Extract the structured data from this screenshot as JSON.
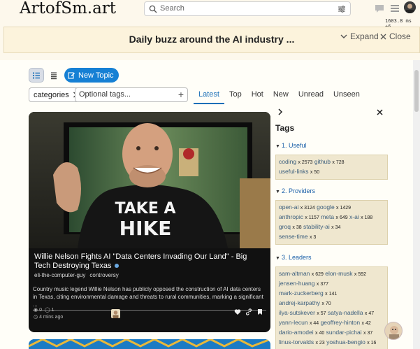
{
  "header": {
    "logo": "ArtofSm.art",
    "search_placeholder": "Search",
    "perf_readout": "1603.8 ms +6"
  },
  "banner": {
    "title": "Daily buzz around the AI industry ...",
    "expand_label": "Expand",
    "close_label": "Close"
  },
  "toolbar": {
    "new_topic_label": "New Topic",
    "categories_label": "categories",
    "tags_placeholder": "Optional tags...",
    "tabs": [
      {
        "label": "Latest",
        "active": true
      },
      {
        "label": "Top",
        "active": false
      },
      {
        "label": "Hot",
        "active": false
      },
      {
        "label": "New",
        "active": false
      },
      {
        "label": "Unread",
        "active": false
      },
      {
        "label": "Unseen",
        "active": false
      }
    ]
  },
  "card": {
    "title": "Willie Nelson Fights AI \"Data Centers Invading Our Land\" - Big Tech Destroying Texas",
    "tags": [
      "eli-the-computer-guy",
      "controversy"
    ],
    "excerpt": "Country music legend Willie Nelson has publicly opposed the construction of AI data centers in Texas, citing environmental damage and threats to rural communities, marking a significant ...",
    "views": "0",
    "replies": "1",
    "time": "4 mins ago",
    "shirt_text_1": "TAKE A",
    "shirt_text_2": "HIKE"
  },
  "tags_panel": {
    "title": "Tags",
    "sections": [
      {
        "label": "1. Useful",
        "lines": [
          [
            {
              "tag": "coding",
              "count": "x 2573"
            },
            {
              "tag": "github",
              "count": "x 728"
            }
          ],
          [
            {
              "tag": "useful-links",
              "count": "x 50"
            }
          ]
        ]
      },
      {
        "label": "2. Providers",
        "lines": [
          [
            {
              "tag": "open-ai",
              "count": "x 3124"
            },
            {
              "tag": "google",
              "count": "x 1429"
            }
          ],
          [
            {
              "tag": "anthropic",
              "count": "x 1157"
            },
            {
              "tag": "meta",
              "count": "x 649"
            },
            {
              "tag": "x-ai",
              "count": "x 188"
            }
          ],
          [
            {
              "tag": "groq",
              "count": "x 38"
            },
            {
              "tag": "stability-ai",
              "count": "x 34"
            }
          ],
          [
            {
              "tag": "sense-time",
              "count": "x 3"
            }
          ]
        ]
      },
      {
        "label": "3. Leaders",
        "lines": [
          [
            {
              "tag": "sam-altman",
              "count": "x 629"
            },
            {
              "tag": "elon-musk",
              "count": "x 592"
            }
          ],
          [
            {
              "tag": "jensen-huang",
              "count": "x 377"
            }
          ],
          [
            {
              "tag": "mark-zuckerberg",
              "count": "x 141"
            }
          ],
          [
            {
              "tag": "andrej-karpathy",
              "count": "x 70"
            }
          ],
          [
            {
              "tag": "ilya-sutskever",
              "count": "x 57"
            },
            {
              "tag": "satya-nadella",
              "count": "x 47"
            }
          ],
          [
            {
              "tag": "yann-lecun",
              "count": "x 44"
            },
            {
              "tag": "geoffrey-hinton",
              "count": "x 42"
            }
          ],
          [
            {
              "tag": "dario-amodei",
              "count": "x 40"
            },
            {
              "tag": "sundar-pichai",
              "count": "x 37"
            }
          ],
          [
            {
              "tag": "linus-torvalds",
              "count": "x 23"
            },
            {
              "tag": "yoshua-bengio",
              "count": "x 16"
            }
          ]
        ]
      }
    ]
  },
  "colors": {
    "accent": "#1680d4",
    "background": "#fdf8ec",
    "card_bg": "#111111",
    "tag_box": "#efe7cf"
  }
}
